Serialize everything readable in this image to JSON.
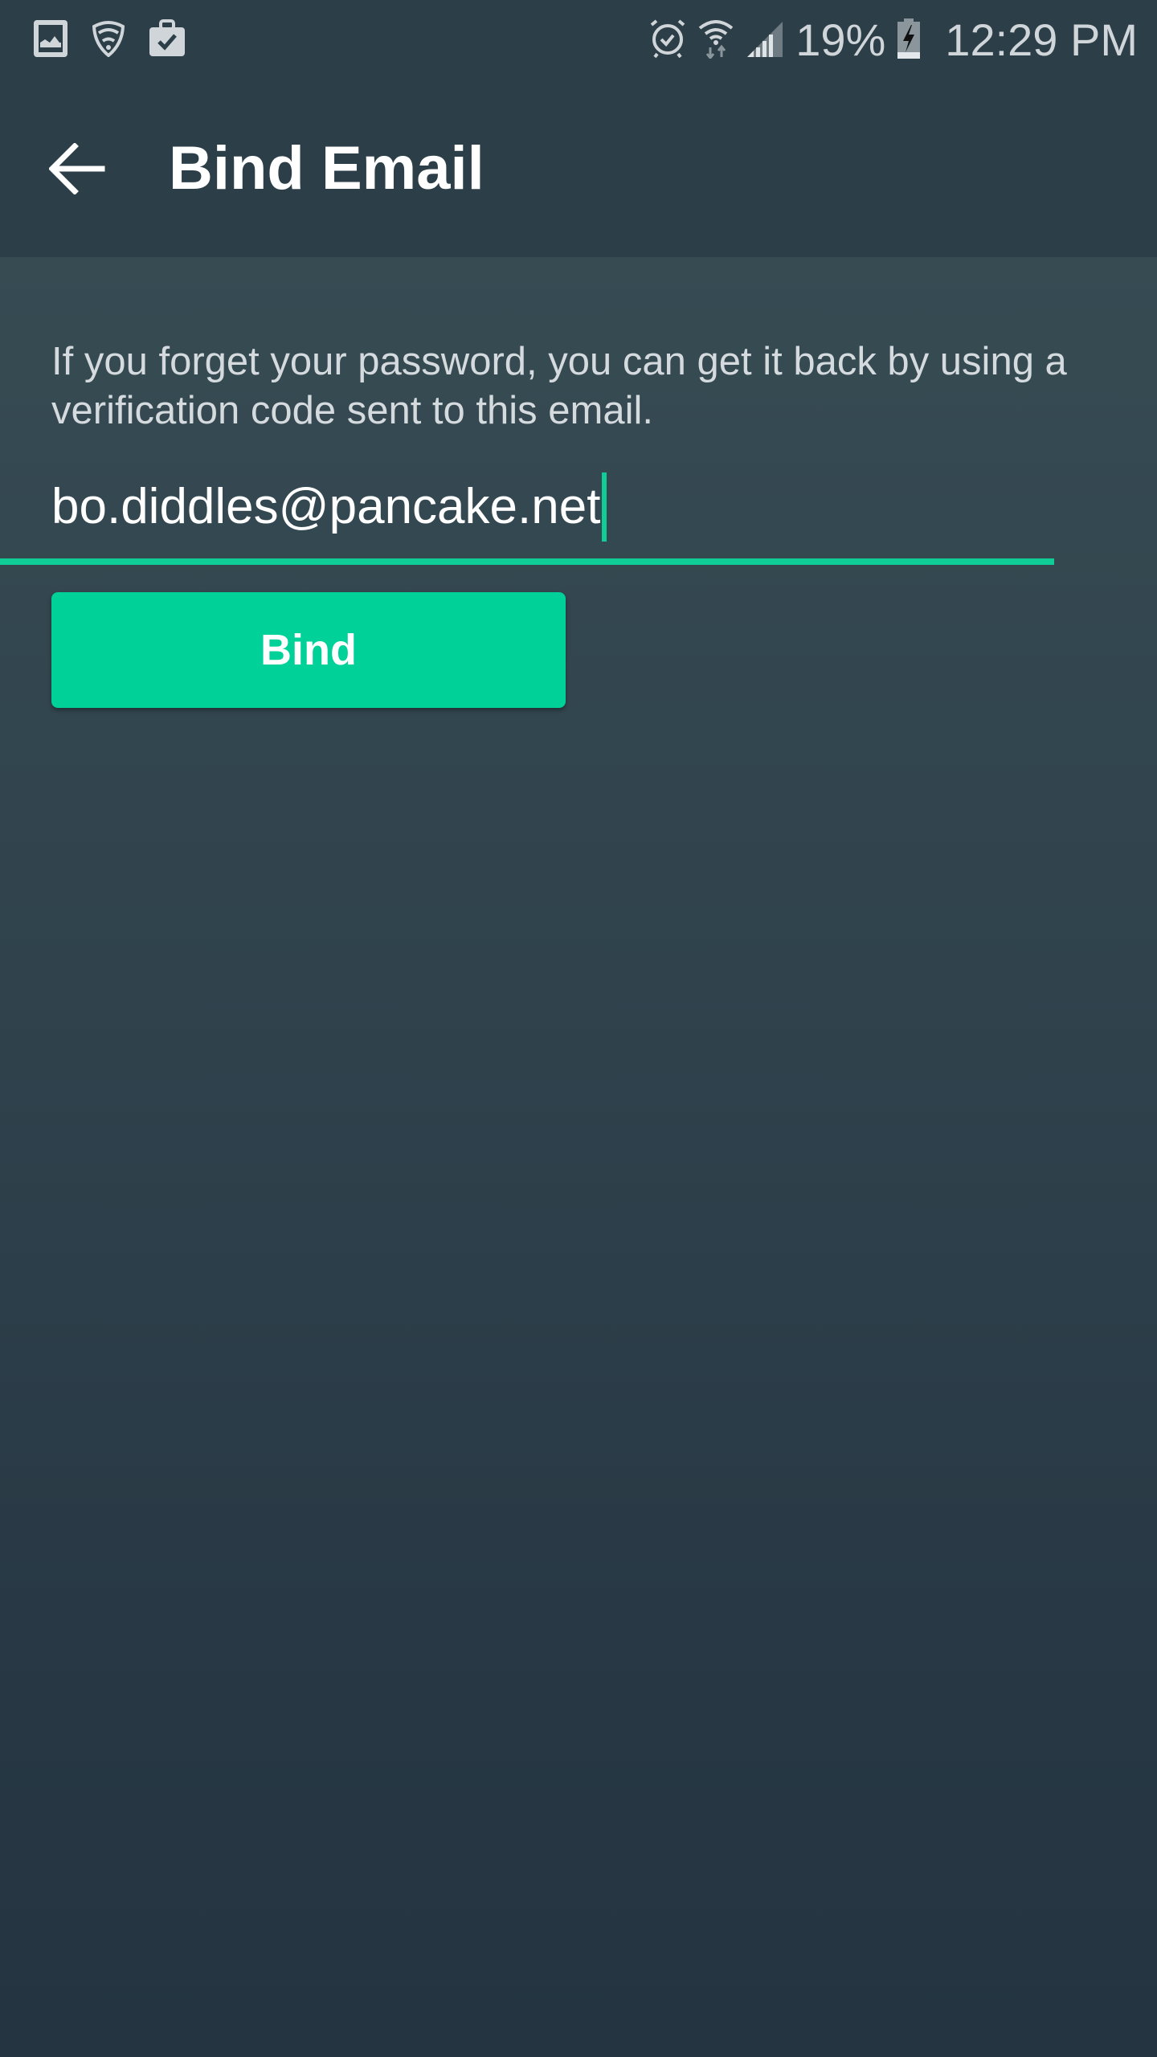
{
  "status_bar": {
    "left_icons": [
      "gallery-icon",
      "secure-wifi-icon",
      "work-briefcase-icon"
    ],
    "right_icons": [
      "alarm-icon",
      "wifi-data-icon",
      "signal-icon",
      "battery-charging-icon"
    ],
    "battery_percent": "19%",
    "time": "12:29 PM"
  },
  "app_bar": {
    "back_icon": "arrow-left-icon",
    "title": "Bind Email"
  },
  "form": {
    "hint": "If you forget your password, you can get it back by using a verification code sent to this email.",
    "email_value": "bo.diddles@pancake.net",
    "bind_label": "Bind"
  },
  "colors": {
    "accent": "#00d198",
    "underline": "#10cc97",
    "header_bg": "#2c3e48",
    "content_bg_top": "#374b53",
    "content_bg_bottom": "#243441"
  }
}
